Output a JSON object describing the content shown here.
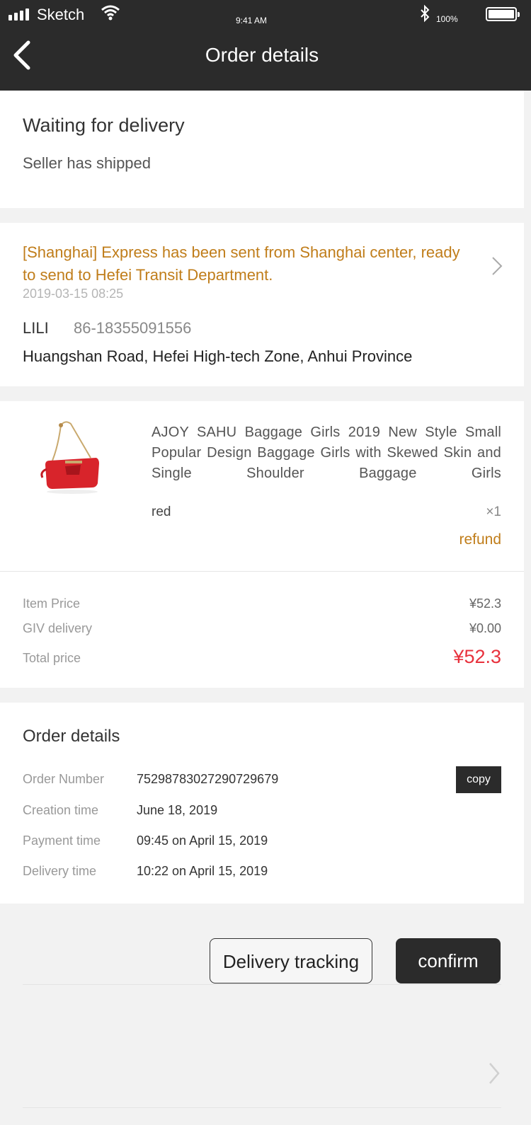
{
  "status_bar": {
    "carrier": "Sketch",
    "time": "9:41 AM",
    "battery": "100%"
  },
  "nav": {
    "title": "Order details"
  },
  "order_status": {
    "heading": "Waiting for delivery",
    "subtext": "Seller has shipped"
  },
  "shipping": {
    "message": "[Shanghai] Express has been sent from Shanghai center, ready to send to Hefei Transit Department.",
    "date": "2019-03-15  08:25",
    "recipient_name": "LILI",
    "phone": "86-18355091556",
    "address": "Huangshan Road, Hefei High-tech Zone, Anhui Province"
  },
  "product": {
    "title": "AJOY SAHU Baggage Girls 2019 New Style Small Popular Design Baggage Girls with Skewed Skin and Single Shoulder Baggage Girls",
    "spec": "red",
    "quantity": "×1",
    "refund_label": "refund",
    "image_color": "#d8242b"
  },
  "pricing": {
    "item_price_label": "Item Price",
    "item_price": "¥52.3",
    "delivery_label": "GIV delivery",
    "delivery": "¥0.00",
    "total_label": "Total price",
    "total": "¥52.3"
  },
  "order_details": {
    "heading": "Order details",
    "order_number_label": "Order Number",
    "order_number": "75298783027290729679",
    "copy_label": "copy",
    "creation_label": "Creation time",
    "creation": "June 18, 2019",
    "payment_label": "Payment time",
    "payment": "09:45 on April 15, 2019",
    "delivery_label": "Delivery time",
    "delivery": "10:22 on April 15, 2019"
  },
  "actions": {
    "tracking_label": "Delivery tracking",
    "confirm_label": "confirm"
  },
  "colors": {
    "header": "#2b2b2b",
    "accent": "#c07d1a",
    "total": "#e8313c"
  }
}
